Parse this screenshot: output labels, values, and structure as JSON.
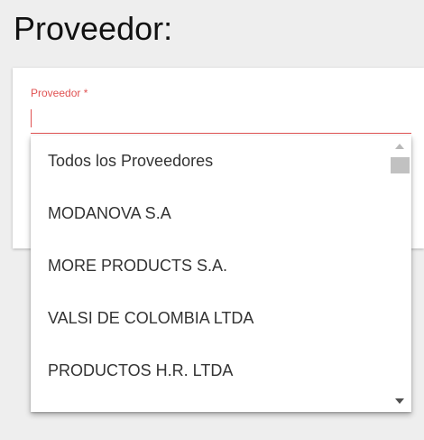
{
  "page": {
    "title": "Proveedor:"
  },
  "form": {
    "supplier_field": {
      "label": "Proveedor *",
      "value": ""
    }
  },
  "dropdown": {
    "options": [
      "Todos los Proveedores",
      "MODANOVA S.A",
      "MORE PRODUCTS S.A.",
      "VALSI DE COLOMBIA LTDA",
      "PRODUCTOS H.R. LTDA"
    ],
    "scroll_position": 0.0
  },
  "icons": {
    "scroll_up": "triangle-up-icon",
    "scroll_down": "triangle-down-icon"
  },
  "colors": {
    "accent": "#e05252",
    "background": "#eeeeee",
    "card": "#ffffff",
    "text": "#333333"
  }
}
